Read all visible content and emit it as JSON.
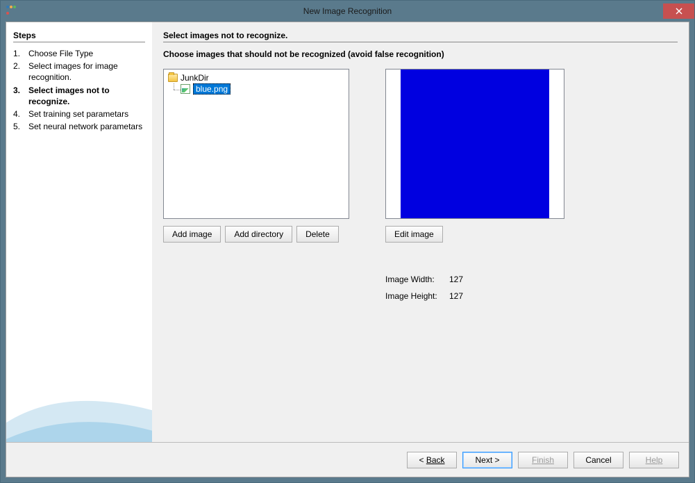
{
  "titlebar": {
    "title": "New Image Recognition"
  },
  "sidebar": {
    "heading": "Steps",
    "steps": [
      {
        "num": "1.",
        "text": "Choose File Type"
      },
      {
        "num": "2.",
        "text": "Select images for image recognition."
      },
      {
        "num": "3.",
        "text": "Select images not to recognize."
      },
      {
        "num": "4.",
        "text": "Set training set parametars"
      },
      {
        "num": "5.",
        "text": "Set neural network parametars"
      }
    ],
    "current_index": 2
  },
  "main": {
    "title": "Select images not to recognize.",
    "subtitle": "Choose images that should not be recognized (avoid false recognition)",
    "tree": {
      "folder": "JunkDir",
      "file": "blue.png"
    },
    "buttons": {
      "add_image": "Add image",
      "add_directory": "Add directory",
      "delete": "Delete",
      "edit_image": "Edit image"
    },
    "info": {
      "width_label": "Image Width:",
      "width_value": "127",
      "height_label": "Image Height:",
      "height_value": "127"
    },
    "preview_color": "#0000e0"
  },
  "footer": {
    "back": "Back",
    "next": "Next >",
    "finish": "Finish",
    "cancel": "Cancel",
    "help": "Help"
  }
}
